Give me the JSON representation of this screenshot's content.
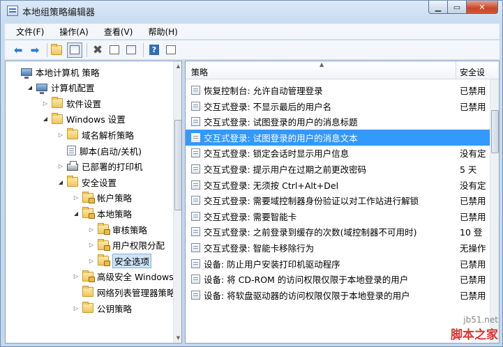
{
  "window": {
    "title": "本地组策略编辑器"
  },
  "menu": [
    "文件(F)",
    "操作(A)",
    "查看(V)",
    "帮助(H)"
  ],
  "toolbar": {
    "icons": [
      "back-arrow-icon",
      "forward-arrow-icon",
      "up-folder-icon",
      "show-hide-tree-icon",
      "delete-icon",
      "properties-icon",
      "export-list-icon",
      "help-icon",
      "extended-view-icon"
    ],
    "help_glyph": "?"
  },
  "tree": [
    {
      "label": "本地计算机 策略",
      "level": 0,
      "icon": "computer-policy-icon",
      "expand": "none"
    },
    {
      "label": "计算机配置",
      "level": 1,
      "icon": "computer-icon",
      "expand": "open"
    },
    {
      "label": "软件设置",
      "level": 2,
      "icon": "folder-icon",
      "expand": "closed"
    },
    {
      "label": "Windows 设置",
      "level": 2,
      "icon": "folder-icon",
      "expand": "open"
    },
    {
      "label": "域名解析策略",
      "level": 3,
      "icon": "folder-icon",
      "expand": "closed"
    },
    {
      "label": "脚本(启动/关机)",
      "level": 3,
      "icon": "script-icon",
      "expand": "none"
    },
    {
      "label": "已部署的打印机",
      "level": 3,
      "icon": "printer-icon",
      "expand": "closed"
    },
    {
      "label": "安全设置",
      "level": 3,
      "icon": "security-folder-icon",
      "expand": "open"
    },
    {
      "label": "帐户策略",
      "level": 4,
      "icon": "locked-folder-icon",
      "expand": "closed"
    },
    {
      "label": "本地策略",
      "level": 4,
      "icon": "locked-folder-icon",
      "expand": "open"
    },
    {
      "label": "审核策略",
      "level": 5,
      "icon": "locked-folder-icon",
      "expand": "closed"
    },
    {
      "label": "用户权限分配",
      "level": 5,
      "icon": "locked-folder-icon",
      "expand": "closed"
    },
    {
      "label": "安全选项",
      "level": 5,
      "icon": "locked-folder-icon",
      "expand": "closed",
      "selected": true
    },
    {
      "label": "高级安全 Windows",
      "level": 4,
      "icon": "locked-folder-icon",
      "expand": "closed"
    },
    {
      "label": "网络列表管理器策略",
      "level": 4,
      "icon": "folder-icon",
      "expand": "none"
    },
    {
      "label": "公钥策略",
      "level": 4,
      "icon": "folder-icon",
      "expand": "closed"
    }
  ],
  "list": {
    "columns": [
      "策略",
      "安全设"
    ],
    "rows": [
      {
        "policy": "恢复控制台: 允许自动管理登录",
        "setting": "已禁用"
      },
      {
        "policy": "交互式登录: 不显示最后的用户名",
        "setting": "已禁用"
      },
      {
        "policy": "交互式登录: 试图登录的用户的消息标题",
        "setting": ""
      },
      {
        "policy": "交互式登录: 试图登录的用户的消息文本",
        "setting": "",
        "selected": true
      },
      {
        "policy": "交互式登录: 锁定会话时显示用户信息",
        "setting": "没有定"
      },
      {
        "policy": "交互式登录: 提示用户在过期之前更改密码",
        "setting": "5 天"
      },
      {
        "policy": "交互式登录: 无须按 Ctrl+Alt+Del",
        "setting": "没有定"
      },
      {
        "policy": "交互式登录: 需要域控制器身份验证以对工作站进行解锁",
        "setting": "已禁用"
      },
      {
        "policy": "交互式登录: 需要智能卡",
        "setting": "已禁用"
      },
      {
        "policy": "交互式登录: 之前登录到缓存的次数(域控制器不可用时)",
        "setting": "10 登"
      },
      {
        "policy": "交互式登录: 智能卡移除行为",
        "setting": "无操作"
      },
      {
        "policy": "设备: 防止用户安装打印机驱动程序",
        "setting": "已禁用"
      },
      {
        "policy": "设备: 将 CD-ROM 的访问权限仅限于本地登录的用户",
        "setting": "已禁用"
      },
      {
        "policy": "设备: 将软盘驱动器的访问权限仅限于本地登录的用户",
        "setting": "已禁用"
      }
    ]
  },
  "watermark": {
    "url": "jb51.net",
    "name": "脚本之家"
  }
}
